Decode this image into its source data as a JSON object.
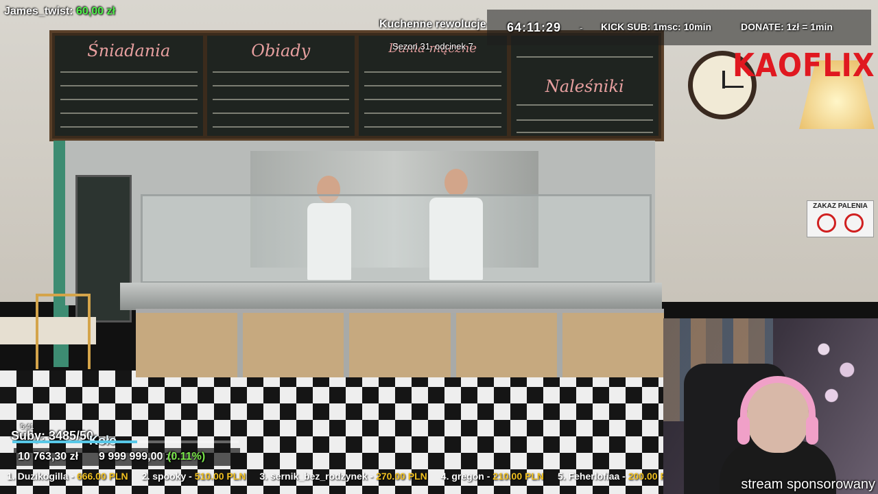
{
  "top_donor": {
    "name": "James_twist:",
    "amount": "60,00 zł"
  },
  "show": {
    "title": "Kuchenne rewolucje",
    "episode": "Sezon 31, odcinek 7"
  },
  "stream_timer": "64:11:29",
  "separator": "-",
  "kick_sub": "KICK SUB: 1msc: 10min",
  "donate_rate": "DONATE: 1zł = 1min",
  "brand": "KAOFLIX",
  "menu_boards": [
    "Śniadania",
    "Obiady",
    "Dania mączne",
    "Naleśniki"
  ],
  "wall_sign": "ZAKAZ PALENIA",
  "subs_widget": {
    "clip_time": "5:41",
    "label": "Suby: 3485/50",
    "wheel_label": "Koło",
    "progress": 0.55
  },
  "donation_goal": {
    "current": "10 763,30 zł",
    "target": "9 999 999,00 zł",
    "percent": "(0.11%)"
  },
  "top_donors": [
    {
      "rank": "1.",
      "name": "Duzikogilla",
      "amount": "666.00 PLN"
    },
    {
      "rank": "2.",
      "name": "spooky",
      "amount": "510.00 PLN"
    },
    {
      "rank": "3.",
      "name": "sernik_bez_rodzynek",
      "amount": "270.00 PLN"
    },
    {
      "rank": "4.",
      "name": "gregon",
      "amount": "210.00 PLN"
    },
    {
      "rank": "5.",
      "name": "Feherlofiaa",
      "amount": "200.00 PLN"
    }
  ],
  "sponsored": "stream sponsorowany",
  "colors": {
    "accent_green": "#4ef04a",
    "brand_red": "#e01820",
    "donor_amount": "#f0c020"
  }
}
